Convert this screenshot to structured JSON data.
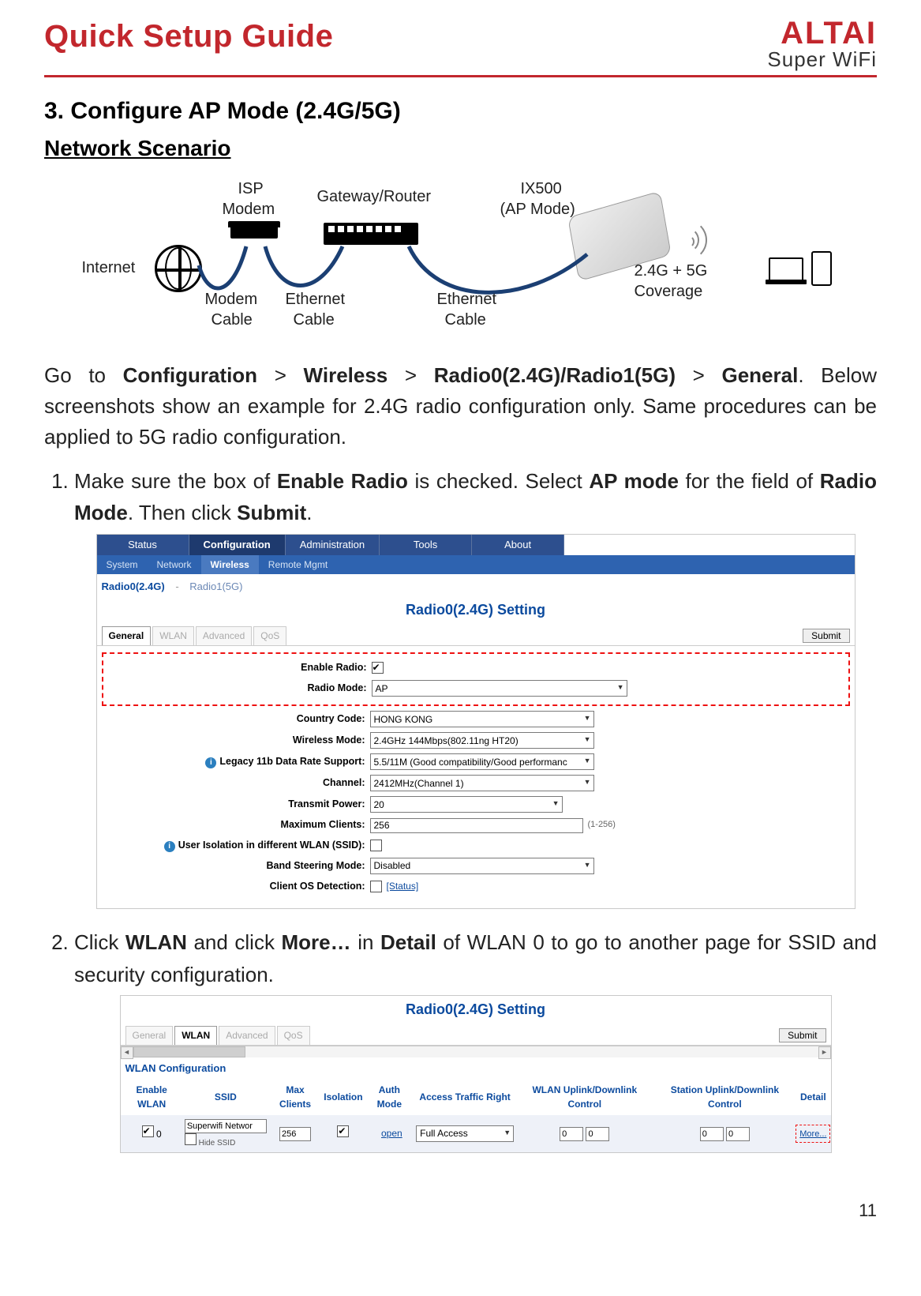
{
  "header": {
    "title": "Quick Setup Guide",
    "logo_main": "ALTAI",
    "logo_sub": "Super WiFi"
  },
  "section": {
    "number": "3.",
    "heading": "Configure AP Mode (2.4G/5G)",
    "subheading": "Network Scenario"
  },
  "diagram": {
    "internet": "Internet",
    "isp_modem_l1": "ISP",
    "isp_modem_l2": "Modem",
    "gateway": "Gateway/Router",
    "ix500_l1": "IX500",
    "ix500_l2": "(AP Mode)",
    "modem_cable_l1": "Modem",
    "modem_cable_l2": "Cable",
    "eth_cable1_l1": "Ethernet",
    "eth_cable1_l2": "Cable",
    "eth_cable2_l1": "Ethernet",
    "eth_cable2_l2": "Cable",
    "coverage_l1": "2.4G + 5G",
    "coverage_l2": "Coverage"
  },
  "intro": {
    "pre": "Go to ",
    "nav1": "Configuration",
    "sep": " > ",
    "nav2": "Wireless",
    "nav3": "Radio0(2.4G)/Radio1(5G)",
    "nav4": "General",
    "post": ". Below screenshots show an example for 2.4G radio configuration only. Same procedures can be applied to 5G radio configuration."
  },
  "step1": {
    "t1": "Make sure the box of ",
    "b1": "Enable Radio",
    "t2": " is checked. Select ",
    "b2": "AP mode",
    "t3": " for the field of ",
    "b3": "Radio Mode",
    "t4": ". Then click ",
    "b4": "Submit",
    "t5": "."
  },
  "step2": {
    "t1": "Click ",
    "b1": "WLAN",
    "t2": " and click ",
    "b2": "More…",
    "t3": " in ",
    "b3": "Detail",
    "t4": " of WLAN 0 to go to another page for SSID and security configuration."
  },
  "shot1": {
    "top_tabs": [
      "Status",
      "Configuration",
      "Administration",
      "Tools",
      "About"
    ],
    "sub_tabs": [
      "System",
      "Network",
      "Wireless",
      "Remote Mgmt"
    ],
    "sub_sel_index": 2,
    "radio_tabs": {
      "r0": "Radio0(2.4G)",
      "sep": "-",
      "r1": "Radio1(5G)"
    },
    "panel_title": "Radio0(2.4G) Setting",
    "gen_tabs": [
      "General",
      "WLAN",
      "Advanced",
      "QoS"
    ],
    "gen_sel": 0,
    "submit": "Submit",
    "fields": {
      "enable_radio": {
        "label": "Enable Radio:",
        "checked": true
      },
      "radio_mode": {
        "label": "Radio Mode:",
        "value": "AP"
      },
      "country": {
        "label": "Country Code:",
        "value": "HONG KONG"
      },
      "wireless_mode": {
        "label": "Wireless Mode:",
        "value": "2.4GHz 144Mbps(802.11ng HT20)"
      },
      "legacy": {
        "label": "Legacy 11b Data Rate Support:",
        "value": "5.5/11M (Good compatibility/Good performanc",
        "info": true
      },
      "channel": {
        "label": "Channel:",
        "value": "2412MHz(Channel 1)"
      },
      "tx_power": {
        "label": "Transmit Power:",
        "value": "20"
      },
      "max_clients": {
        "label": "Maximum Clients:",
        "value": "256",
        "note": "(1-256)"
      },
      "isolation": {
        "label": "User Isolation in different WLAN (SSID):",
        "checked": false,
        "info": true
      },
      "band_steer": {
        "label": "Band Steering Mode:",
        "value": "Disabled"
      },
      "os_detect": {
        "label": "Client OS Detection:",
        "checked": false,
        "status_link": "[Status]"
      }
    }
  },
  "shot2": {
    "panel_title": "Radio0(2.4G) Setting",
    "gen_tabs": [
      "General",
      "WLAN",
      "Advanced",
      "QoS"
    ],
    "gen_sel": 1,
    "submit": "Submit",
    "wlan_conf": "WLAN Configuration",
    "columns": [
      "Enable WLAN",
      "SSID",
      "Max Clients",
      "Isolation",
      "Auth Mode",
      "Access Traffic Right",
      "WLAN Uplink/Downlink Control",
      "Station Uplink/Downlink Control",
      "Detail"
    ],
    "row": {
      "idx": "0",
      "enable_checked": true,
      "ssid": "Superwifi Networ",
      "hide_ssid_label": "Hide SSID",
      "hide_ssid_checked": false,
      "max_clients": "256",
      "isolation_checked": true,
      "auth_mode": "open",
      "access": "Full Access",
      "wlan_up": "0",
      "wlan_dn": "0",
      "sta_up": "0",
      "sta_dn": "0",
      "detail": "More..."
    }
  },
  "page_number": "11"
}
